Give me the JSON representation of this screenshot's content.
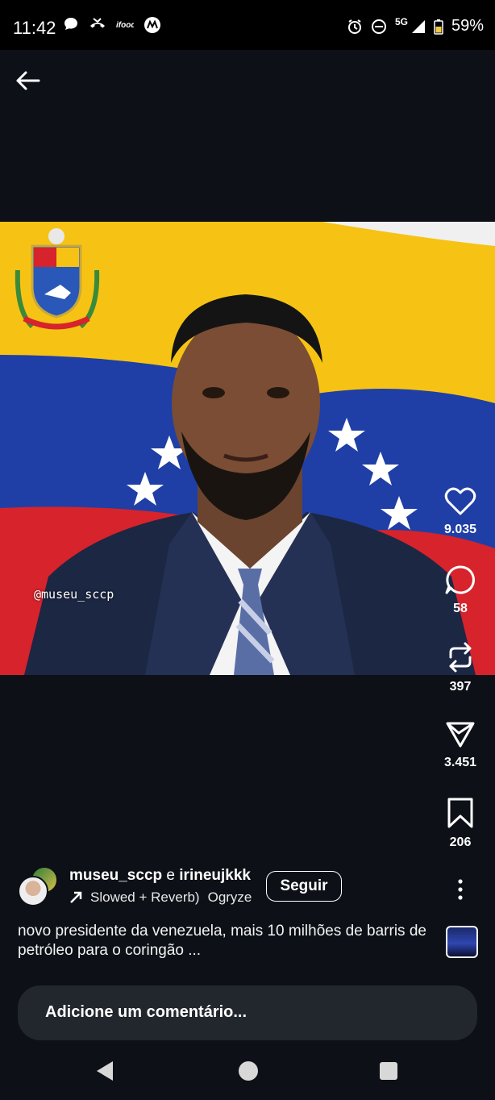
{
  "status_bar": {
    "time": "11:42",
    "network": "5G",
    "battery": "59%",
    "icons": [
      "chat-bubble-icon",
      "missed-call-icon",
      "ifood-icon",
      "motorola-icon",
      "alarm-icon",
      "dnd-icon",
      "signal-icon",
      "battery-icon"
    ]
  },
  "post": {
    "watermark": "@museu_sccp",
    "authors": {
      "first": "museu_sccp",
      "conj": "e",
      "second": "irineujkkk"
    },
    "music": {
      "track": "Slowed + Reverb)",
      "artist": "Ogryze"
    },
    "follow_label": "Seguir",
    "caption": "novo presidente da venezuela, mais 10 milhões de barris de petróleo para o coringão ..."
  },
  "actions": {
    "likes": "9.035",
    "comments": "58",
    "reposts": "397",
    "shares": "3.451",
    "saves": "206"
  },
  "comment_box": {
    "placeholder": "Adicione um comentário..."
  },
  "colors": {
    "background": "#0d1117",
    "flag_yellow": "#f6c315",
    "flag_blue": "#1f3fa6",
    "flag_red": "#d7232b",
    "comment_bg": "#22262d"
  }
}
